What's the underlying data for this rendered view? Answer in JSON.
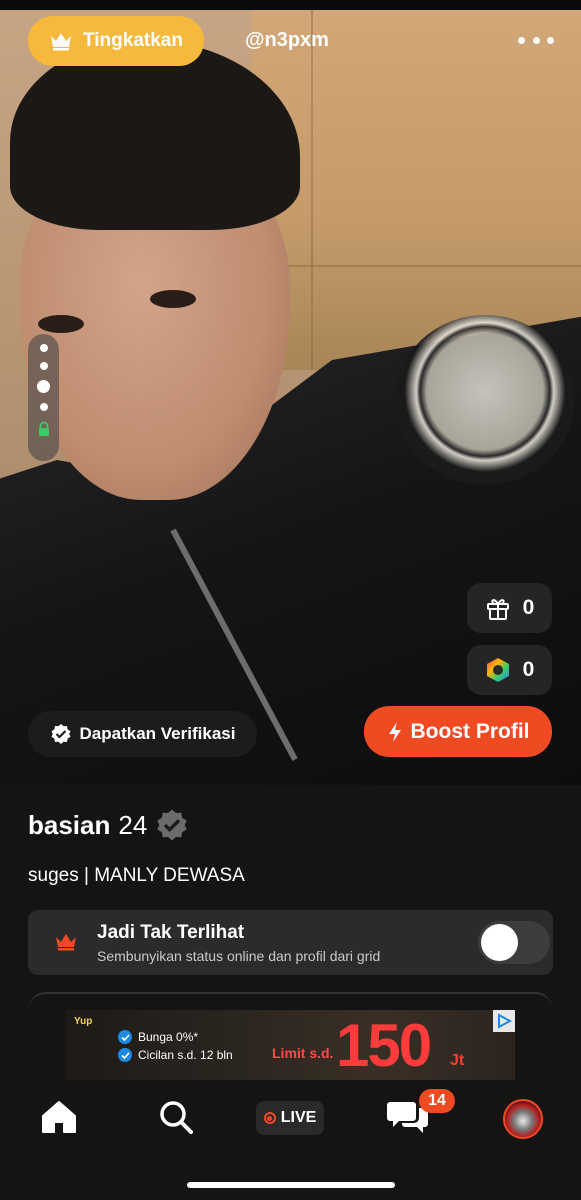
{
  "header": {
    "upgrade_label": "Tingkatkan",
    "username": "@n3pxm"
  },
  "photo": {
    "pages_total": 4,
    "pages_locked": 1
  },
  "stats": {
    "gifts": "0",
    "coins": "0"
  },
  "actions": {
    "verify_label": "Dapatkan Verifikasi",
    "boost_label": "Boost Profil"
  },
  "profile": {
    "name": "basian",
    "age": "24",
    "bio": "suges | MANLY DEWASA"
  },
  "invisible": {
    "title": "Jadi Tak Terlihat",
    "subtitle": "Sembunyikan status online dan profil dari grid",
    "enabled": false
  },
  "ad": {
    "brand": "Yup",
    "feature_1": "Bunga 0%*",
    "feature_2": "Cicilan s.d. 12 bln",
    "limit_label": "Limit s.d.",
    "amount": "150",
    "unit": "Jt"
  },
  "nav": {
    "live_label": "LIVE",
    "chat_badge": "14"
  },
  "colors": {
    "upgrade": "#f6b93b",
    "boost": "#f04a23",
    "background": "#141414"
  }
}
